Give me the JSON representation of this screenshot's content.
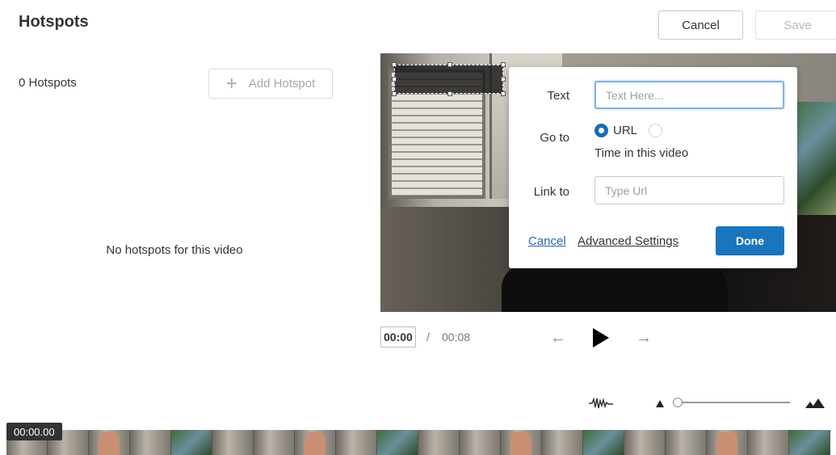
{
  "header": {
    "title": "Hotspots",
    "cancel_label": "Cancel",
    "save_label": "Save"
  },
  "sidebar": {
    "count_text": "0 Hotspots",
    "add_label": "Add Hotspot",
    "empty_message": "No hotspots for this video"
  },
  "popup": {
    "text_label": "Text",
    "text_placeholder": "Text Here...",
    "goto_label": "Go to",
    "option_url": "URL",
    "option_time": "Time in this video",
    "link_label": "Link to",
    "link_placeholder": "Type Url",
    "cancel_link": "Cancel",
    "advanced_link": "Advanced Settings",
    "done_label": "Done"
  },
  "player": {
    "current_time": "00:00",
    "separator": "/",
    "total_time": "00:08"
  },
  "timeline": {
    "time_badge": "00:00.00",
    "zoom_level": 0.02
  },
  "colors": {
    "accent": "#1b75bc",
    "link": "#2a66b5"
  }
}
